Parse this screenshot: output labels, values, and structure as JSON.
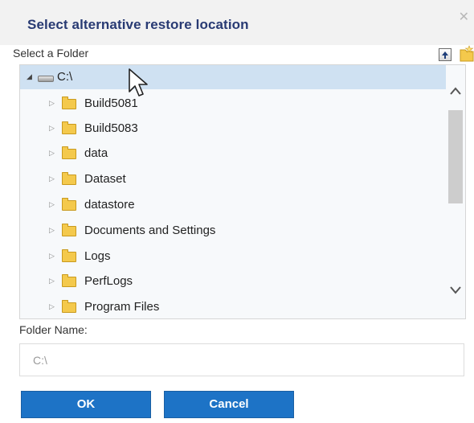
{
  "dialog": {
    "title": "Select alternative restore location",
    "close_icon": "close-icon"
  },
  "folder_browser": {
    "header_label": "Select a Folder",
    "toolbar": {
      "up_icon": "folder-up-icon",
      "new_folder_icon": "new-folder-icon"
    },
    "tree": {
      "root": {
        "label": "C:\\",
        "icon": "drive-icon",
        "expanded": true,
        "selected": true
      },
      "children": [
        {
          "label": "Build5081",
          "icon": "folder-icon"
        },
        {
          "label": "Build5083",
          "icon": "folder-icon"
        },
        {
          "label": "data",
          "icon": "folder-icon"
        },
        {
          "label": "Dataset",
          "icon": "folder-icon"
        },
        {
          "label": "datastore",
          "icon": "folder-icon"
        },
        {
          "label": "Documents and Settings",
          "icon": "folder-icon"
        },
        {
          "label": "Logs",
          "icon": "folder-icon"
        },
        {
          "label": "PerfLogs",
          "icon": "folder-icon"
        },
        {
          "label": "Program Files",
          "icon": "folder-icon"
        }
      ]
    }
  },
  "folder_name": {
    "label": "Folder Name:",
    "value": "C:\\"
  },
  "buttons": {
    "ok_label": "OK",
    "cancel_label": "Cancel"
  },
  "colors": {
    "title": "#283a73",
    "selection": "#cfe1f2",
    "button": "#1d73c6",
    "folder": "#f4c94c"
  }
}
